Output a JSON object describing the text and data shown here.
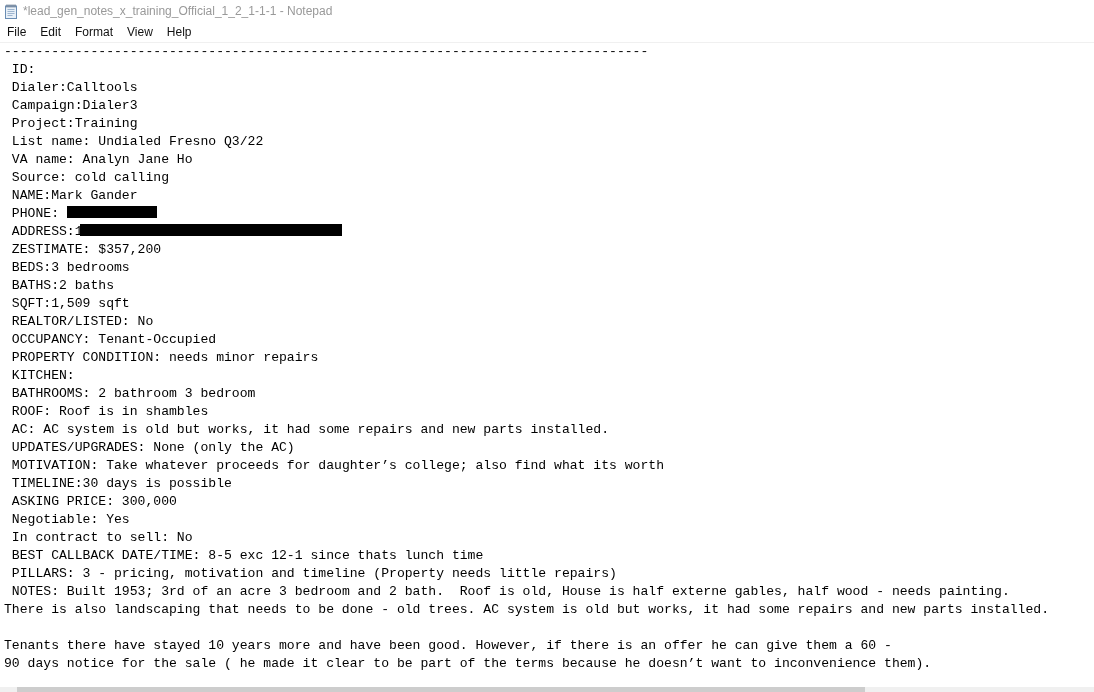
{
  "window": {
    "title": "*lead_gen_notes_x_training_Official_1_2_1-1-1 - Notepad"
  },
  "menu": [
    "File",
    "Edit",
    "Format",
    "View",
    "Help"
  ],
  "document": {
    "lines": [
      {
        "kind": "text",
        "indented": false,
        "text": "----------------------------------------------------------------------------------"
      },
      {
        "kind": "text",
        "indented": true,
        "text": "ID:"
      },
      {
        "kind": "text",
        "indented": true,
        "text": "Dialer:Calltools"
      },
      {
        "kind": "text",
        "indented": true,
        "text": "Campaign:Dialer3"
      },
      {
        "kind": "text",
        "indented": true,
        "text": "Project:Training"
      },
      {
        "kind": "text",
        "indented": true,
        "text": "List name: Undialed Fresno Q3/22"
      },
      {
        "kind": "text",
        "indented": true,
        "text": "VA name: Analyn Jane Ho"
      },
      {
        "kind": "text",
        "indented": true,
        "text": "Source: cold calling"
      },
      {
        "kind": "text",
        "indented": true,
        "text": "NAME:Mark Gander"
      },
      {
        "kind": "redacted",
        "indented": true,
        "text": "PHONE:"
      },
      {
        "kind": "redacted",
        "indented": true,
        "text": "ADDRESS:1"
      },
      {
        "kind": "text",
        "indented": true,
        "text": "ZESTIMATE: $357,200"
      },
      {
        "kind": "text",
        "indented": true,
        "text": "BEDS:3 bedrooms"
      },
      {
        "kind": "text",
        "indented": true,
        "text": "BATHS:2 baths"
      },
      {
        "kind": "text",
        "indented": true,
        "text": "SQFT:1,509 sqft"
      },
      {
        "kind": "text",
        "indented": true,
        "text": "REALTOR/LISTED: No"
      },
      {
        "kind": "text",
        "indented": true,
        "text": "OCCUPANCY: Tenant-Occupied"
      },
      {
        "kind": "text",
        "indented": true,
        "text": "PROPERTY CONDITION: needs minor repairs"
      },
      {
        "kind": "text",
        "indented": true,
        "text": "KITCHEN:"
      },
      {
        "kind": "text",
        "indented": true,
        "text": "BATHROOMS: 2 bathroom 3 bedroom"
      },
      {
        "kind": "text",
        "indented": true,
        "text": "ROOF: Roof is in shambles"
      },
      {
        "kind": "text",
        "indented": true,
        "text": "AC: AC system is old but works, it had some repairs and new parts installed."
      },
      {
        "kind": "text",
        "indented": true,
        "text": "UPDATES/UPGRADES: None (only the AC)"
      },
      {
        "kind": "text",
        "indented": true,
        "text": "MOTIVATION: Take whatever proceeds for daughter’s college; also find what its worth"
      },
      {
        "kind": "text",
        "indented": true,
        "text": "TIMELINE:30 days is possible"
      },
      {
        "kind": "text",
        "indented": true,
        "text": "ASKING PRICE: 300,000"
      },
      {
        "kind": "text",
        "indented": true,
        "text": "Negotiable: Yes"
      },
      {
        "kind": "text",
        "indented": true,
        "text": "In contract to sell: No"
      },
      {
        "kind": "text",
        "indented": true,
        "text": "BEST CALLBACK DATE/TIME: 8-5 exc 12-1 since thats lunch time"
      },
      {
        "kind": "text",
        "indented": true,
        "text": "PILLARS: 3 - pricing, motivation and timeline (Property needs little repairs)"
      },
      {
        "kind": "text",
        "indented": true,
        "text": "NOTES: Built 1953; 3rd of an acre 3 bedroom and 2 bath.  Roof is old, House is half externe gables, half wood - needs painting."
      },
      {
        "kind": "text",
        "indented": false,
        "text": "There is also landscaping that needs to be done - old trees. AC system is old but works, it had some repairs and new parts installed."
      },
      {
        "kind": "blank"
      },
      {
        "kind": "text",
        "indented": false,
        "text": "Tenants there have stayed 10 years more and have been good. However, if there is an offer he can give them a 60 -"
      },
      {
        "kind": "text",
        "indented": false,
        "text": "90 days notice for the sale ( he made it clear to be part of the terms because he doesn’t want to inconvenience them)."
      }
    ]
  }
}
